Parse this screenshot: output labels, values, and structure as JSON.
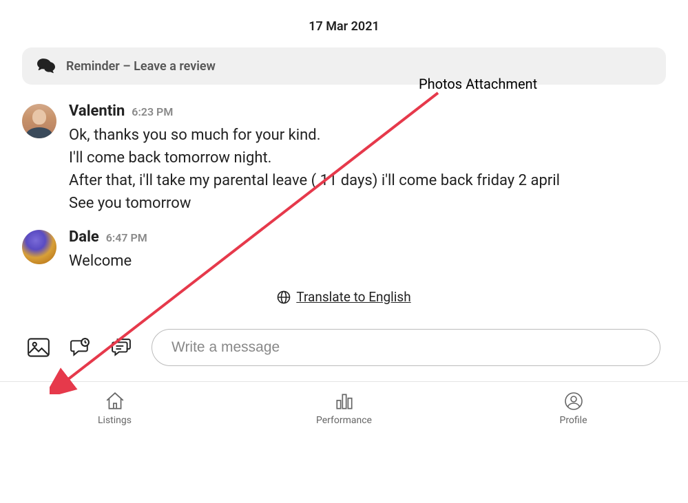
{
  "date_header": "17 Mar 2021",
  "reminder": {
    "text": "Reminder – Leave a review"
  },
  "annotation": {
    "label": "Photos Attachment"
  },
  "messages": [
    {
      "sender": "Valentin",
      "time": "6:23 PM",
      "text": "Ok, thanks you so much for your kind.\nI'll come back tomorrow night.\nAfter that, i'll take my parental leave ( 11 days) i'll come back friday 2 april\nSee you tomorrow"
    },
    {
      "sender": "Dale",
      "time": "6:47 PM",
      "text": "Welcome"
    }
  ],
  "translate": {
    "label": "Translate to English"
  },
  "composer": {
    "placeholder": "Write a message"
  },
  "nav": {
    "listings": "Listings",
    "performance": "Performance",
    "profile": "Profile"
  },
  "colors": {
    "annotation_arrow": "#e6394b"
  }
}
